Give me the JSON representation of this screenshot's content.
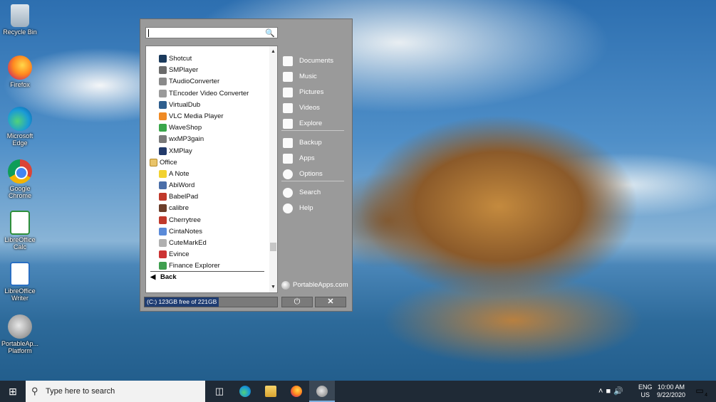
{
  "desktop": {
    "icons": [
      {
        "label": "Recycle Bin",
        "icon": "recycle-bin-icon"
      },
      {
        "label": "Firefox",
        "icon": "firefox-icon"
      },
      {
        "label": "Microsoft Edge",
        "icon": "edge-icon"
      },
      {
        "label": "Google Chrome",
        "icon": "chrome-icon"
      },
      {
        "label": "LibreOffice Calc",
        "icon": "libreoffice-calc-icon"
      },
      {
        "label": "LibreOffice Writer",
        "icon": "libreoffice-writer-icon"
      },
      {
        "label": "PortableAp... Platform",
        "icon": "portableapps-icon"
      }
    ]
  },
  "menu": {
    "search_value": "",
    "list": [
      {
        "label": "Shotcut",
        "kind": "app"
      },
      {
        "label": "SMPlayer",
        "kind": "app"
      },
      {
        "label": "TAudioConverter",
        "kind": "app"
      },
      {
        "label": "TEncoder Video Converter",
        "kind": "app"
      },
      {
        "label": "VirtualDub",
        "kind": "app"
      },
      {
        "label": "VLC Media Player",
        "kind": "app"
      },
      {
        "label": "WaveShop",
        "kind": "app"
      },
      {
        "label": "wxMP3gain",
        "kind": "app"
      },
      {
        "label": "XMPlay",
        "kind": "app"
      },
      {
        "label": "Office",
        "kind": "folder"
      },
      {
        "label": "A Note",
        "kind": "app"
      },
      {
        "label": "AbiWord",
        "kind": "app"
      },
      {
        "label": "BabelPad",
        "kind": "app"
      },
      {
        "label": "calibre",
        "kind": "app"
      },
      {
        "label": "Cherrytree",
        "kind": "app"
      },
      {
        "label": "CintaNotes",
        "kind": "app"
      },
      {
        "label": "CuteMarkEd",
        "kind": "app"
      },
      {
        "label": "Evince",
        "kind": "app"
      },
      {
        "label": "Finance Explorer",
        "kind": "app"
      }
    ],
    "back_label": "Back",
    "nav": [
      {
        "label": "Documents",
        "icon": "documents-icon"
      },
      {
        "label": "Music",
        "icon": "music-icon"
      },
      {
        "label": "Pictures",
        "icon": "pictures-icon"
      },
      {
        "label": "Videos",
        "icon": "videos-icon"
      },
      {
        "label": "Explore",
        "icon": "folder-icon"
      },
      {
        "label": "Backup",
        "icon": "backup-icon"
      },
      {
        "label": "Apps",
        "icon": "apps-icon"
      },
      {
        "label": "Options",
        "icon": "gear-icon"
      },
      {
        "label": "Search",
        "icon": "search-icon"
      },
      {
        "label": "Help",
        "icon": "help-icon"
      }
    ],
    "brand": "PortableApps.com",
    "drive_status": "(C:) 123GB free of 221GB",
    "drive_free_fraction": 0.56,
    "power_symbol": "⏻",
    "close_symbol": "✕"
  },
  "taskbar": {
    "search_placeholder": "Type here to search",
    "lang": "ENG",
    "region": "US",
    "time": "10:00 AM",
    "date": "9/22/2020",
    "notifications": "4"
  }
}
